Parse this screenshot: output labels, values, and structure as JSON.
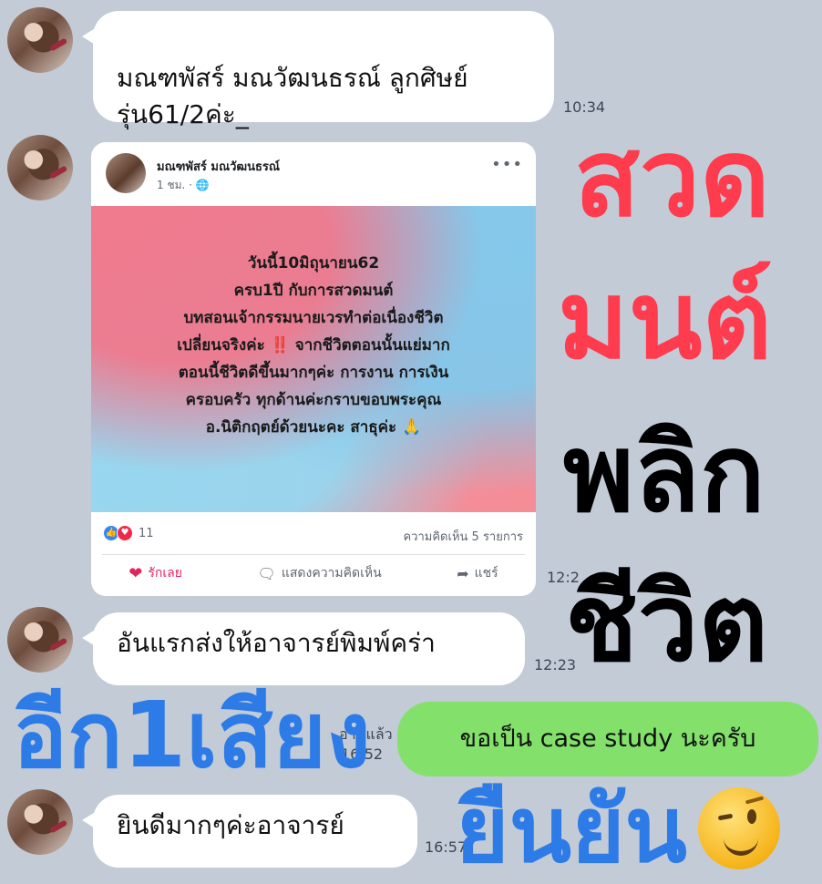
{
  "messages": [
    {
      "text": "มณฑพัสร์ มณวัฒนธรณ์ ลูกศิษย์\nรุ่น61/2ค่ะ_",
      "time": "10:34"
    },
    {
      "time": "12:2"
    },
    {
      "text": "อันแรกส่งให้อาจารย์พิมพ์คร่า",
      "time": "12:23"
    },
    {
      "text": "ยินดีมากๆค่ะอาจารย์",
      "time": "16:57"
    }
  ],
  "fb_post": {
    "author": "มณฑพัสร์ มณวัฒนธรณ์",
    "meta": "1 ชม. · ",
    "more": "•••",
    "text": "วันนี้10มิถุนายน62\nครบ1ปี กับการสวดมนต์\nบทสอนเจ้ากรรมนายเวรทำต่อเนื่องชีวิต\nเปลี่ยนจริงค่ะ ‼️ จากชีวิตตอนนั้นแย่มาก\nตอนนี้ชีวิตดีขึ้นมากๆค่ะ การงาน การเงิน\nครอบครัว ทุกด้านค่ะกราบขอบพระคุณ\nอ.นิติกฤตย์ด้วยนะคะ สาธุค่ะ 🙏",
    "reaction_count": "11",
    "comments": "ความคิดเห็น 5 รายการ",
    "actions": {
      "love": "รักเลย",
      "comment": "แสดงความคิดเห็น",
      "share": "แชร์"
    }
  },
  "sent": {
    "text": "ขอเป็น case study นะครับ",
    "read": "อ่านแล้ว",
    "time": "16:52"
  },
  "overlay": {
    "w1": "สวด",
    "w2": "มนต์",
    "w3": "พลิก",
    "w4": "ชีวิต",
    "w5": "อีก1เสียง",
    "w6": "ยืนยัน"
  },
  "colors": {
    "red": "#ff3b4e",
    "black": "#000000",
    "blue": "#2d7be6",
    "green_bubble": "#83e16b"
  }
}
